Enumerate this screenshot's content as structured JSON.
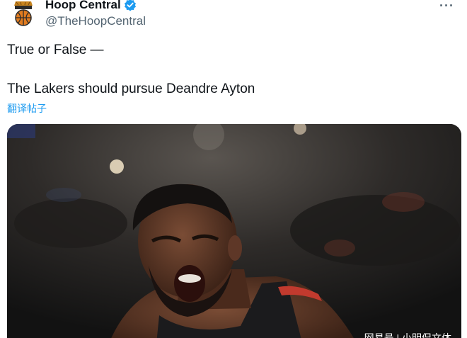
{
  "author": {
    "display_name": "Hoop Central",
    "handle": "@TheHoopCentral",
    "verified": true,
    "avatar_icon": "basketball-logo-icon",
    "verified_color": "#1d9bf0"
  },
  "menu": {
    "more_icon": "more-horizontal-icon",
    "more_label": "···"
  },
  "tweet": {
    "line1": "True or False —",
    "line2": "The Lakers should pursue Deandre Ayton",
    "translate_label": "翻译帖子",
    "link_color": "#1d9bf0"
  },
  "media": {
    "watermark": "网易号 | 小明侃文体"
  }
}
